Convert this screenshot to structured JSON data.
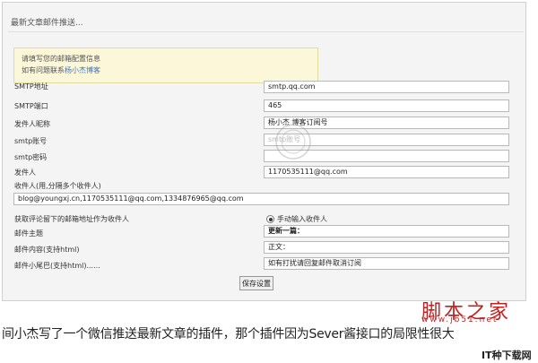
{
  "panel": {
    "title": "最新文章邮件推送..."
  },
  "notice": {
    "line1": "请填写您的邮箱配置信息",
    "line2_prefix": "如有问题联系",
    "line2_link": "杨小杰博客"
  },
  "fields": [
    {
      "label": "SMTP地址",
      "value": "smtp.qq.com"
    },
    {
      "label": "SMTP端口",
      "value": "465"
    },
    {
      "label": "发件人昵称",
      "value": "杨小杰 博客订阅号"
    },
    {
      "label": "smtp账号",
      "value": "smtp账号"
    },
    {
      "label": "smtp密码",
      "value": ""
    },
    {
      "label": "发件人",
      "value": "1170535111@qq.com"
    }
  ],
  "recipients": {
    "label": "收件人(用,分隔多个收件人)",
    "value": "blog@youngxj.cn,1170535111@qq.com,1334876965@qq.com"
  },
  "comment_option": {
    "label": "获取评论留下的邮箱地址作为收件人",
    "radio_label": "手动输入收件人"
  },
  "mail_subject": {
    "label": "邮件主题",
    "value": "更新一篇："
  },
  "mail_content": {
    "label": "邮件内容(支持html)",
    "value": "正文："
  },
  "mail_tail": {
    "label": "邮件小尾巴(支持html)......",
    "value": "如有打扰请回复邮件取消订阅"
  },
  "save_button": {
    "label": "保存设置"
  },
  "caption": "间小杰写了一个微信推送最新文章的插件，那个插件因为Sever酱接口的局限性很大",
  "watermark": {
    "main": "脚本之家",
    "url": "www.jb51.net",
    "corner": "IT种下载网"
  },
  "colors": {
    "link": "#3a78c4",
    "notice_bg": "#fbf7d8",
    "watermark": "#c41f1f"
  }
}
